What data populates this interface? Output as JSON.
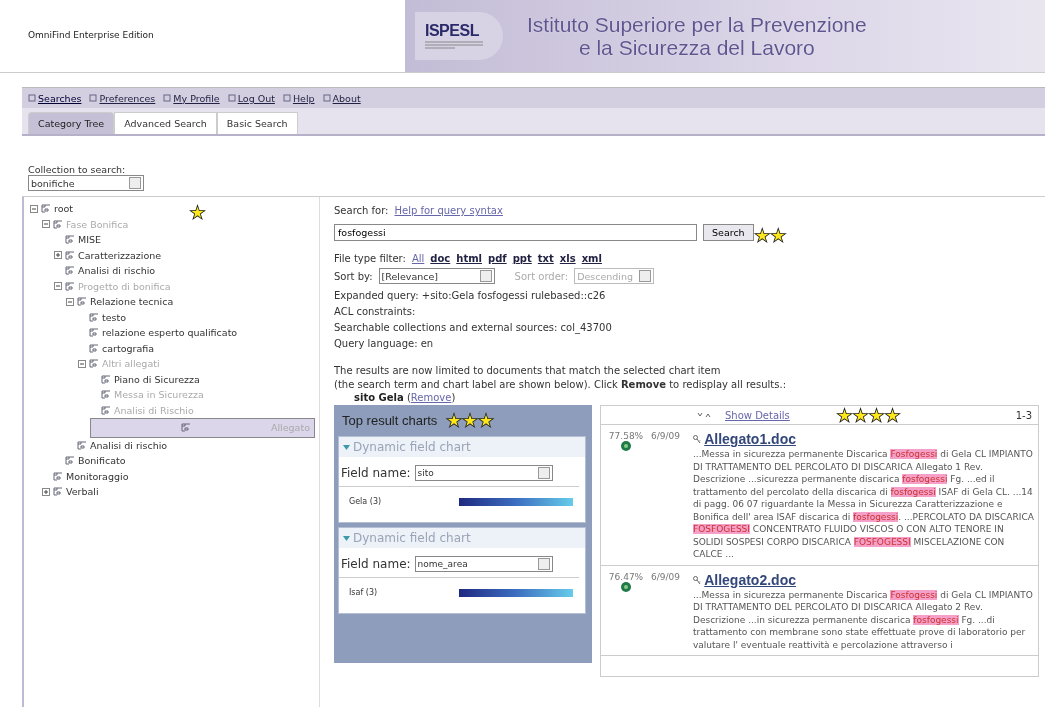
{
  "header": {
    "product": "OmniFind Enterprise Edition",
    "logo": "ISPESL",
    "title_lines": [
      "Istituto Superiore per la Prevenzione",
      "e la Sicurezza del Lavoro"
    ]
  },
  "menu": [
    {
      "label": "Searches",
      "selected": true
    },
    {
      "label": "Preferences",
      "selected": false
    },
    {
      "label": "My Profile",
      "selected": false
    },
    {
      "label": "Log Out",
      "selected": false
    },
    {
      "label": "Help",
      "selected": false
    },
    {
      "label": "About",
      "selected": false
    }
  ],
  "tabs": [
    {
      "label": "Category Tree",
      "selected": true
    },
    {
      "label": "Advanced Search",
      "selected": false
    },
    {
      "label": "Basic Search",
      "selected": false
    }
  ],
  "collection": {
    "label": "Collection to search:",
    "value": "bonifiche"
  },
  "tree": {
    "marker": "★",
    "nodes": [
      {
        "label": "root",
        "kind": "branch",
        "expanded": true,
        "dimmed": false,
        "selected": false,
        "children": [
          {
            "label": "Fase Bonifica",
            "kind": "branch",
            "expanded": true,
            "dimmed": true,
            "selected": false,
            "children": [
              {
                "label": "MISE",
                "kind": "leaf",
                "dimmed": false,
                "selected": false
              },
              {
                "label": "Caratterizzazione",
                "kind": "branch",
                "expanded": false,
                "dimmed": false,
                "selected": false
              },
              {
                "label": "Analisi di rischio",
                "kind": "leaf",
                "dimmed": false,
                "selected": false
              },
              {
                "label": "Progetto di bonifica",
                "kind": "branch",
                "expanded": true,
                "dimmed": true,
                "selected": false,
                "children": [
                  {
                    "label": "Relazione tecnica",
                    "kind": "branch",
                    "expanded": true,
                    "dimmed": false,
                    "selected": false,
                    "children": [
                      {
                        "label": "testo",
                        "kind": "leaf",
                        "dimmed": false,
                        "selected": false
                      },
                      {
                        "label": "relazione esperto qualificato",
                        "kind": "leaf",
                        "dimmed": false,
                        "selected": false
                      },
                      {
                        "label": "cartografia",
                        "kind": "leaf",
                        "dimmed": false,
                        "selected": false
                      },
                      {
                        "label": "Altri allegati",
                        "kind": "branch",
                        "expanded": true,
                        "dimmed": true,
                        "selected": false,
                        "children": [
                          {
                            "label": "Piano di Sicurezza",
                            "kind": "leaf",
                            "dimmed": false,
                            "selected": false
                          },
                          {
                            "label": "Messa in Sicurezza",
                            "kind": "leaf",
                            "dimmed": true,
                            "selected": false
                          },
                          {
                            "label": "Analisi di Rischio",
                            "kind": "leaf",
                            "dimmed": true,
                            "selected": false
                          },
                          {
                            "label": "Allegato",
                            "kind": "leaf",
                            "dimmed": true,
                            "selected": true
                          }
                        ]
                      }
                    ]
                  },
                  {
                    "label": "Analisi di rischio",
                    "kind": "leaf",
                    "dimmed": false,
                    "selected": false
                  }
                ]
              },
              {
                "label": "Bonificato",
                "kind": "leaf",
                "dimmed": false,
                "selected": false
              }
            ]
          },
          {
            "label": "Monitoraggio",
            "kind": "leaf",
            "dimmed": false,
            "selected": false
          },
          {
            "label": "Verbali",
            "kind": "branch",
            "expanded": false,
            "dimmed": false,
            "selected": false
          }
        ]
      }
    ]
  },
  "search": {
    "marker": "★★",
    "label": "Search for:",
    "help_link": "Help for query syntax",
    "query": "fosfogessi",
    "button": "Search",
    "filter_label": "File type filter:",
    "filters": [
      {
        "label": "All",
        "selected": true
      },
      {
        "label": "doc",
        "selected": false
      },
      {
        "label": "html",
        "selected": false
      },
      {
        "label": "pdf",
        "selected": false
      },
      {
        "label": "ppt",
        "selected": false
      },
      {
        "label": "txt",
        "selected": false
      },
      {
        "label": "xls",
        "selected": false
      },
      {
        "label": "xml",
        "selected": false
      }
    ],
    "sort_label": "Sort by:",
    "sort_value": "[Relevance]",
    "order_label": "Sort order:",
    "order_value": "Descending",
    "order_disabled": true,
    "info": [
      "Expanded query: +sito:Gela fosfogessi rulebased::c26",
      "ACL constraints:",
      "Searchable collections and external sources: col_43700",
      "Query language: en"
    ],
    "notice": "The results are now limited to documents that match the selected chart item\n(the search term and chart label are shown below). Click **Remove** to redisplay all results.:",
    "chip": "sito Gela",
    "chip_open": "(",
    "chip_link": "Remove",
    "chip_close": ")"
  },
  "charts": {
    "title": "Top result charts",
    "marker": "★★★",
    "items": [
      {
        "title": "Dynamic field chart",
        "field_label": "Field name:",
        "field_value": "sito",
        "bar_label": "Gela (3)"
      },
      {
        "title": "Dynamic field chart",
        "field_label": "Field name:",
        "field_value": "nome_area",
        "bar_label": "Isaf (3)"
      }
    ]
  },
  "results": {
    "marker": "★★★★",
    "show_details": "Show Details",
    "range": "1-3",
    "items": [
      {
        "score": "77.58%",
        "date": "6/9/09",
        "title": "Allegato1.doc",
        "snippet": "...Messa in sicurezza permanente Discarica **Fosfogessi** di Gela CL IMPIANTO DI TRATTAMENTO DEL PERCOLATO DI DISCARICA Allegato 1 Rev. Descrizione ...sicurezza permanente discarica **fosfogessi** Fg. ...ed il trattamento del percolato della discarica di **fosfogessi** ISAF di Gela CL. ...14 di pagg. 06 07 riguardante la Messa in Sicurezza Caratterizzazione e Bonifica dell' area ISAF discarica di **fosfogessi**. ...PERCOLATO DA DISCARICA **FOSFOGESSI** CONCENTRATO FLUIDO VISCOS O CON ALTO TENORE IN SOLIDI SOSPESI CORPO DISCARICA **FOSFOGESSI** MISCELAZIONE CON CALCE ..."
      },
      {
        "score": "76.47%",
        "date": "6/9/09",
        "title": "Allegato2.doc",
        "snippet": "...Messa in sicurezza permanente Discarica **Fosfogessi** di Gela CL IMPIANTO DI TRATTAMENTO DEL PERCOLATO DI DISCARICA Allegato 2 Rev. Descrizione ...in sicurezza permanente discarica **fosfogessi** Fg. ...di trattamento con membrane sono state effettuate prove di laboratorio per valutare l' eventuale reattività e percolazione attraverso i"
      }
    ]
  }
}
